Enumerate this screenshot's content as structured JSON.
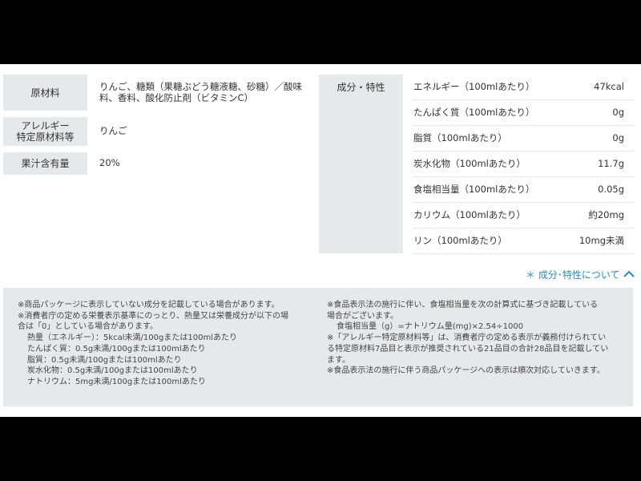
{
  "info": {
    "ingredients": {
      "label": "原材料",
      "value_lines": [
        "りんご、糖類（果糖ぶどう糖液糖、砂糖）／酸味",
        "料、香料、酸化防止剤（ビタミンC）"
      ]
    },
    "allergens": {
      "label_lines": [
        "アレルギー",
        "特定原材料等"
      ],
      "value": "りんご"
    },
    "juice": {
      "label": "果汁含有量",
      "value": "20%"
    }
  },
  "nutrition": {
    "label": "成分・特性",
    "rows": [
      {
        "name": "エネルギー（100mlあたり）",
        "value": "47kcal"
      },
      {
        "name": "たんぱく質（100mlあたり）",
        "value": "0g"
      },
      {
        "name": "脂質（100mlあたり）",
        "value": "0g"
      },
      {
        "name": "炭水化物（100mlあたり）",
        "value": "11.7g"
      },
      {
        "name": "食塩相当量（100mlあたり）",
        "value": "0.05g"
      },
      {
        "name": "カリウム（100mlあたり）",
        "value": "約20mg"
      },
      {
        "name": "リン（100mlあたり）",
        "value": "10mg未満"
      }
    ]
  },
  "toggle": {
    "label": "＊ 成分･特性について",
    "icon": "chevron-up-icon",
    "color": "#2a8fb8"
  },
  "notes": {
    "left": [
      "※商品パッケージに表示していない成分を記載している場合があります。",
      "※消費者庁の定める栄養表示基準にのっとり、熱量又は栄養成分が以下の場",
      "合は「0」としている場合があります。",
      "熱量（エネルギー）：5kcal未満/100gまたは100mlあたり",
      "たんぱく質：0.5g未満/100gまたは100mlあたり",
      "脂質：0.5g未満/100gまたは100mlあたり",
      "炭水化物：0.5g未満/100gまたは100mlあたり",
      "ナトリウム：5mg未満/100gまたは100mlあたり"
    ],
    "right": [
      "※食品表示法の施行に伴い、食塩相当量を次の計算式に基づき記載している",
      "場合がございます。",
      "食塩相当量（g）=ナトリウム量(mg)×2.54÷1000",
      "※「アレルギー特定原材料等」は、消費者庁の定める表示が義務付けられてい",
      "る特定原材料7品目と表示が推奨されている21品目の合計28品目を記載してい",
      "ます。",
      "※食品表示法の施行に伴う商品パッケージへの表示は順次対応していきます。"
    ]
  }
}
